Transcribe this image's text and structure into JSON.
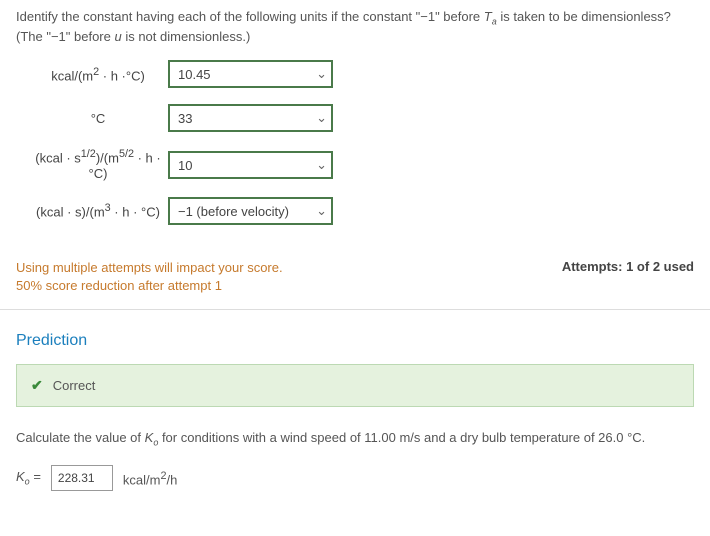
{
  "question": {
    "text_pre": "Identify the constant having each of the following units if the constant \"−1\" before ",
    "t_sym": "T",
    "t_sub": "a",
    "text_mid": " is taken to be dimensionless? (The \"−1\" before ",
    "u_sym": "u",
    "text_end": " is not dimensionless.)"
  },
  "rows": [
    {
      "label_html": "kcal/(m<sup>2</sup> · h ·°C)",
      "value": "10.45"
    },
    {
      "label_html": "°C",
      "value": "33"
    },
    {
      "label_html": "(kcal · s<sup>1/2</sup>)/(m<sup>5/2</sup> · h · °C)",
      "value": "10"
    },
    {
      "label_html": "(kcal · s)/(m<sup>3</sup> · h · °C)",
      "value": "−1 (before velocity)"
    }
  ],
  "impact": {
    "line1": "Using multiple attempts will impact your score.",
    "line2": "50% score reduction after attempt 1"
  },
  "attempts": "Attempts: 1 of 2 used",
  "section_heading": "Prediction",
  "correct_label": "Correct",
  "calc": {
    "text_pre": "Calculate the value of ",
    "k_sym": "K",
    "k_sub": "o",
    "text_end": " for conditions with a wind speed of 11.00 m/s and a dry bulb temperature of 26.0 °C."
  },
  "answer": {
    "sym": "K",
    "sub": "o",
    "eq": "=",
    "value": "228.31",
    "unit_html": "kcal/m<sup>2</sup>/h"
  }
}
